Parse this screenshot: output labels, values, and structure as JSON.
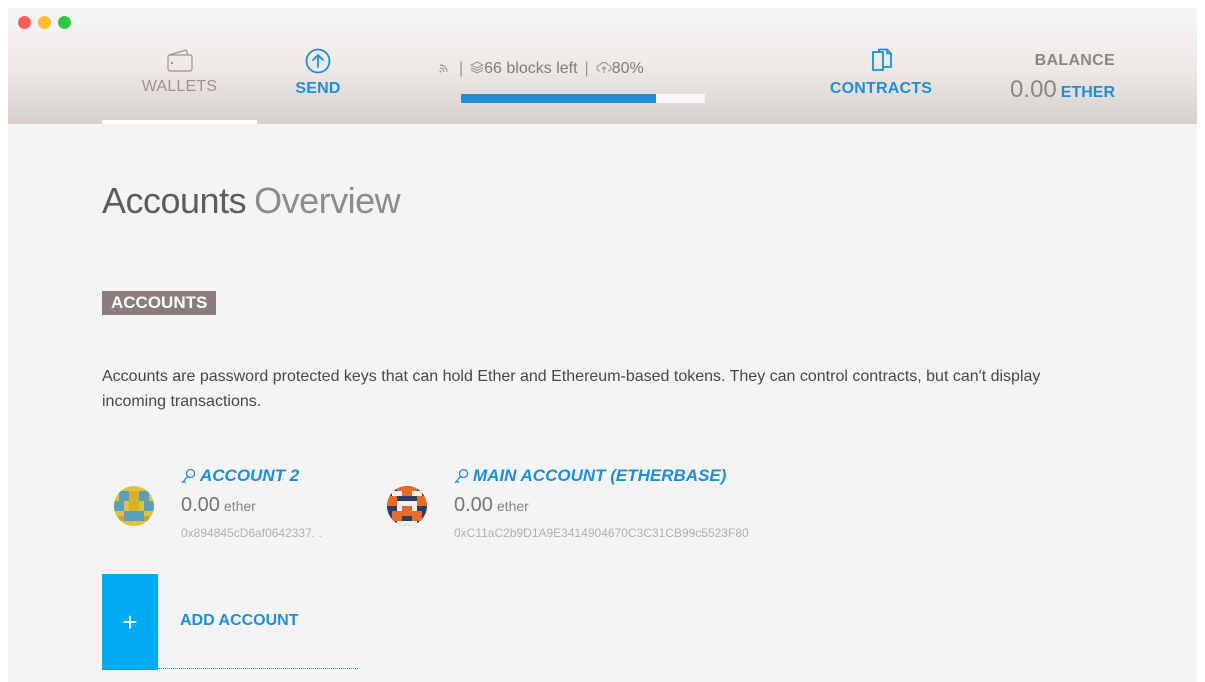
{
  "header": {
    "nav": {
      "wallets_label": "WALLETS",
      "send_label": "SEND",
      "contracts_label": "CONTRACTS"
    },
    "sync": {
      "blocks_left": "66 blocks left",
      "percent_label": "80%",
      "progress": 0.8
    },
    "balance": {
      "label": "BALANCE",
      "value": "0.00",
      "unit": "ETHER"
    }
  },
  "page": {
    "title_strong": "Accounts",
    "title_light": "Overview",
    "section_badge": "ACCOUNTS",
    "description": "Accounts are password protected keys that can hold Ether and Ethereum-based tokens. They can control contracts, but can't display incoming transactions."
  },
  "accounts": [
    {
      "name": "ACCOUNT 2",
      "balance": "0.00",
      "unit": "ether",
      "address": "0x894845cD6af0642337. ."
    },
    {
      "name": "MAIN ACCOUNT (ETHERBASE)",
      "balance": "0.00",
      "unit": "ether",
      "address": "0xC11aC2b9D1A9E3414904670C3C31CB99c5523F80"
    }
  ],
  "add_account": {
    "plus": "+",
    "label": "ADD ACCOUNT"
  },
  "colors": {
    "accent": "#1e8fd6",
    "add_button": "#00aaf0",
    "badge": "#8b7d7b"
  },
  "icons": [
    "wallet-icon",
    "send-arrow-icon",
    "rss-icon",
    "layers-icon",
    "cloud-icon",
    "contracts-icon",
    "key-icon"
  ]
}
